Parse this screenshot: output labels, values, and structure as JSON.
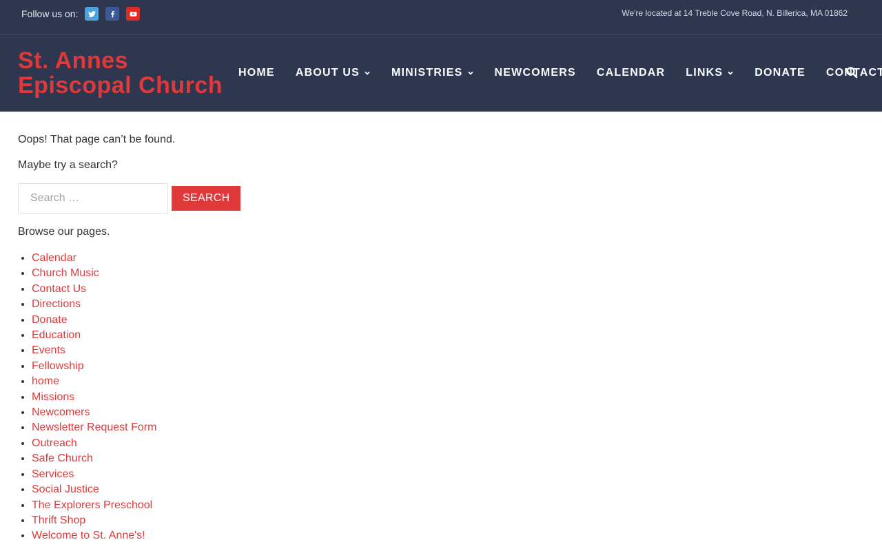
{
  "topbar": {
    "follow_label": "Follow us on:",
    "social": [
      {
        "name": "twitter-icon",
        "color": "#4aa3df"
      },
      {
        "name": "facebook-icon",
        "color": "#3b5998"
      },
      {
        "name": "youtube-icon",
        "color": "#e02a2a"
      }
    ],
    "address": "We're located at 14 Treble Cove Road, N. Billerica, MA 01862"
  },
  "header": {
    "logo_line1": "St. Annes",
    "logo_line2": "Episcopal Church",
    "nav": [
      {
        "label": "HOME",
        "dropdown": false
      },
      {
        "label": "ABOUT US",
        "dropdown": true
      },
      {
        "label": "MINISTRIES",
        "dropdown": true
      },
      {
        "label": "NEWCOMERS",
        "dropdown": false
      },
      {
        "label": "CALENDAR",
        "dropdown": false
      },
      {
        "label": "LINKS",
        "dropdown": true
      },
      {
        "label": "DONATE",
        "dropdown": false
      },
      {
        "label": "CONTACT US",
        "dropdown": false
      }
    ],
    "search_icon": "search-icon"
  },
  "main": {
    "not_found": "Oops! That page can’t be found.",
    "try_search": "Maybe try a search?",
    "search_placeholder": "Search …",
    "search_button": "SEARCH",
    "browse": "Browse our pages.",
    "pages": [
      "Calendar",
      "Church Music",
      "Contact Us",
      "Directions",
      "Donate",
      "Education",
      "Events",
      "Fellowship",
      "home",
      "Missions",
      "Newcomers",
      "Newsletter Request Form",
      "Outreach",
      "Safe Church",
      "Services",
      "Social Justice",
      "The Explorers Preschool",
      "Thrift Shop",
      "Welcome to St. Anne's!"
    ]
  },
  "colors": {
    "header_bg": "#2e3650",
    "accent": "#e0393a"
  }
}
